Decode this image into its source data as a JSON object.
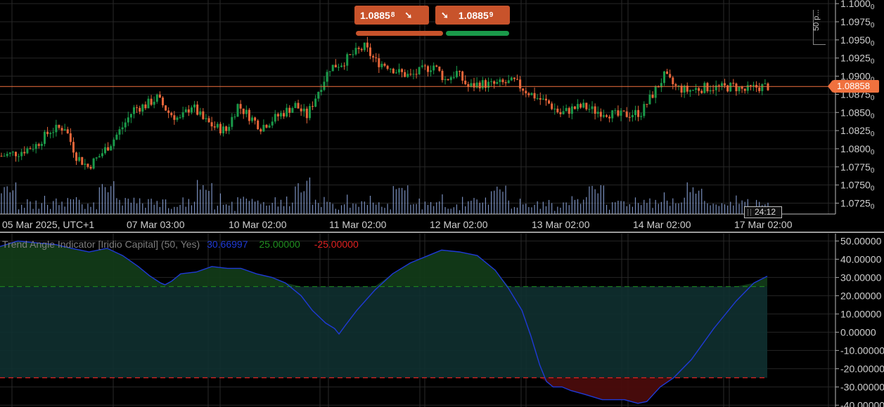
{
  "trade_buttons": {
    "sell_price_main": "1.0885",
    "sell_price_small": "8",
    "sell_arrow": "➘",
    "buy_arrow": "➘",
    "buy_price_main": "1.0885",
    "buy_price_small": "9"
  },
  "current_price": "1.08858",
  "countdown": "24:12",
  "scale_label": "50 p...",
  "price_axis": {
    "ticks": [
      {
        "main": "1.1000",
        "sub": "0",
        "value": 1.1
      },
      {
        "main": "1.0975",
        "sub": "0",
        "value": 1.0975
      },
      {
        "main": "1.0950",
        "sub": "0",
        "value": 1.095
      },
      {
        "main": "1.0925",
        "sub": "0",
        "value": 1.0925
      },
      {
        "main": "1.0900",
        "sub": "0",
        "value": 1.09
      },
      {
        "main": "1.0875",
        "sub": "0",
        "value": 1.0875
      },
      {
        "main": "1.0850",
        "sub": "0",
        "value": 1.085
      },
      {
        "main": "1.0825",
        "sub": "0",
        "value": 1.0825
      },
      {
        "main": "1.0800",
        "sub": "0",
        "value": 1.08
      },
      {
        "main": "1.0775",
        "sub": "0",
        "value": 1.0775
      },
      {
        "main": "1.0750",
        "sub": "0",
        "value": 1.075
      },
      {
        "main": "1.0725",
        "sub": "0",
        "value": 1.0725
      }
    ]
  },
  "time_axis": {
    "labels": [
      "05 Mar 2025, UTC+1",
      "07 Mar 03:00",
      "10 Mar 02:00",
      "11 Mar 02:00",
      "12 Mar 02:00",
      "13 Mar 02:00",
      "14 Mar 02:00",
      "17 Mar 02:00"
    ]
  },
  "indicator": {
    "name": "Trend Angle Indicator [Iridio Capital] (50, Yes)",
    "value": "30.66997",
    "upper": "25.00000",
    "lower": "-25.00000",
    "axis_ticks": [
      "50.00000",
      "40.00000",
      "30.00000",
      "20.00000",
      "10.00000",
      "0.00000",
      "-10.00000",
      "-20.00000",
      "-30.00000",
      "-40.00000"
    ]
  },
  "colors": {
    "bull": "#1a9a4a",
    "bear": "#e8663a",
    "volume": "#8fa8e0",
    "price_line": "#f0713e",
    "indicator_line": "#1f3ad6",
    "upper_line": "#1f8f1f",
    "lower_line": "#e02020",
    "band_fill": "#0f3030"
  },
  "chart_data": [
    {
      "type": "candlestick",
      "title": "",
      "ylim": [
        1.071,
        1.1005
      ],
      "current_price": 1.08858,
      "x_labels": [
        "05 Mar 2025, UTC+1",
        "07 Mar 03:00",
        "10 Mar 02:00",
        "11 Mar 02:00",
        "12 Mar 02:00",
        "13 Mar 02:00",
        "14 Mar 02:00",
        "17 Mar 02:00"
      ],
      "anchors": [
        [
          0,
          1.079
        ],
        [
          6,
          1.0795
        ],
        [
          12,
          1.0805
        ],
        [
          17,
          1.0825
        ],
        [
          22,
          1.083
        ],
        [
          26,
          1.079
        ],
        [
          30,
          1.0775
        ],
        [
          34,
          1.079
        ],
        [
          38,
          1.0808
        ],
        [
          42,
          1.083
        ],
        [
          46,
          1.0855
        ],
        [
          50,
          1.086
        ],
        [
          54,
          1.087
        ],
        [
          58,
          1.085
        ],
        [
          62,
          1.084
        ],
        [
          66,
          1.086
        ],
        [
          70,
          1.084
        ],
        [
          74,
          1.083
        ],
        [
          78,
          1.0825
        ],
        [
          82,
          1.086
        ],
        [
          86,
          1.0845
        ],
        [
          90,
          1.083
        ],
        [
          94,
          1.084
        ],
        [
          98,
          1.085
        ],
        [
          102,
          1.086
        ],
        [
          106,
          1.0845
        ],
        [
          110,
          1.088
        ],
        [
          114,
          1.0912
        ],
        [
          118,
          1.0918
        ],
        [
          122,
          1.093
        ],
        [
          126,
          1.094
        ],
        [
          130,
          1.092
        ],
        [
          134,
          1.0915
        ],
        [
          138,
          1.0905
        ],
        [
          142,
          1.09
        ],
        [
          146,
          1.0908
        ],
        [
          150,
          1.0915
        ],
        [
          154,
          1.0895
        ],
        [
          158,
          1.0905
        ],
        [
          162,
          1.0885
        ],
        [
          166,
          1.089
        ],
        [
          170,
          1.0888
        ],
        [
          174,
          1.089
        ],
        [
          178,
          1.0892
        ],
        [
          182,
          1.088
        ],
        [
          186,
          1.087
        ],
        [
          190,
          1.0862
        ],
        [
          194,
          1.0848
        ],
        [
          198,
          1.0855
        ],
        [
          202,
          1.0858
        ],
        [
          206,
          1.0852
        ],
        [
          210,
          1.085
        ],
        [
          214,
          1.0845
        ],
        [
          218,
          1.0848
        ],
        [
          222,
          1.085
        ],
        [
          226,
          1.0875
        ],
        [
          230,
          1.09
        ],
        [
          234,
          1.0885
        ],
        [
          238,
          1.088
        ],
        [
          242,
          1.0883
        ],
        [
          246,
          1.0885
        ],
        [
          250,
          1.0884
        ],
        [
          254,
          1.0886
        ],
        [
          258,
          1.088
        ],
        [
          262,
          1.0885
        ],
        [
          266,
          1.0886
        ]
      ],
      "candle_count": 267
    },
    {
      "type": "line",
      "title": "Trend Angle Indicator [Iridio Capital] (50, Yes)",
      "ylim": [
        -41,
        54
      ],
      "upper_level": 25.0,
      "lower_level": -25.0,
      "current_value": 30.66997,
      "points": [
        [
          0,
          47
        ],
        [
          8,
          50
        ],
        [
          16,
          49
        ],
        [
          25,
          48
        ],
        [
          32,
          46
        ],
        [
          40,
          44
        ],
        [
          48,
          46
        ],
        [
          55,
          42
        ],
        [
          62,
          36
        ],
        [
          67,
          31
        ],
        [
          72,
          27
        ],
        [
          74,
          26
        ],
        [
          77,
          28
        ],
        [
          81,
          32
        ],
        [
          88,
          33
        ],
        [
          95,
          36
        ],
        [
          102,
          35
        ],
        [
          108,
          35
        ],
        [
          115,
          32
        ],
        [
          122,
          30
        ],
        [
          128,
          27
        ],
        [
          135,
          20
        ],
        [
          140,
          12
        ],
        [
          146,
          5
        ],
        [
          150,
          2
        ],
        [
          152,
          -1
        ],
        [
          155,
          4
        ],
        [
          160,
          12
        ],
        [
          168,
          23
        ],
        [
          176,
          32
        ],
        [
          184,
          38
        ],
        [
          192,
          42
        ],
        [
          198,
          45
        ],
        [
          206,
          44
        ],
        [
          214,
          42
        ],
        [
          222,
          34
        ],
        [
          228,
          24
        ],
        [
          234,
          12
        ],
        [
          238,
          -2
        ],
        [
          242,
          -18
        ],
        [
          245,
          -27
        ],
        [
          248,
          -30
        ],
        [
          252,
          -30
        ],
        [
          256,
          -32
        ],
        [
          262,
          -34
        ],
        [
          270,
          -37
        ],
        [
          280,
          -37
        ],
        [
          286,
          -39
        ],
        [
          290,
          -38
        ],
        [
          296,
          -30
        ],
        [
          302,
          -25
        ],
        [
          310,
          -15
        ],
        [
          320,
          2
        ],
        [
          330,
          17
        ],
        [
          338,
          27
        ],
        [
          344,
          30.67
        ]
      ],
      "x_max": 344
    }
  ]
}
